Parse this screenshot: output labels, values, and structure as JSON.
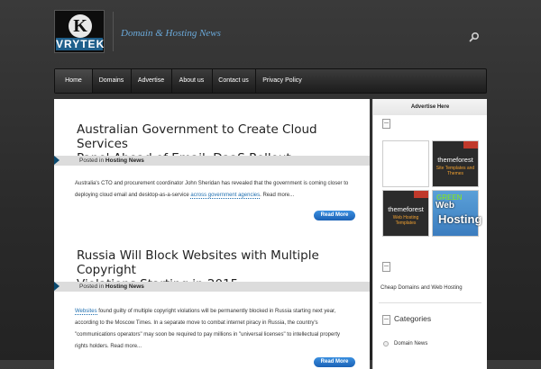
{
  "header": {
    "logo_text": "VRYTEK",
    "tagline": "Domain & Hosting News"
  },
  "nav": {
    "items": [
      "Home",
      "Domains",
      "Advertise",
      "About us",
      "Contact us",
      "Privacy Policy"
    ],
    "active": "Home"
  },
  "posts": [
    {
      "title_line1": "Australian Government to Create Cloud Services",
      "title_line2": "Panel Ahead of Email, DaaS Rollout",
      "posted_label": "Posted in",
      "category": "Hosting News",
      "excerpt_line1": "Australia's CTO and procurement coordinator John Sheridan has revealed that the government is coming closer to",
      "excerpt_line2_pre": "deploying cloud email and desktop-as-a-service ",
      "excerpt_link": "across government agencies",
      "excerpt_line2_post": ". Read more...",
      "button": "Read More"
    },
    {
      "title_line1": "Russia Will Block Websites with Multiple Copyright",
      "title_line2": "Violations Starting in 2015",
      "posted_label": "Posted in",
      "category": "Hosting News",
      "excerpt_link": "Websites",
      "excerpt_line1_post": " found guilty of multiple copyright violations will be permanently blocked in Russia starting next year,",
      "excerpt_line2": "according to the Moscow Times. In a separate move to combat internet piracy in Russia, the country's",
      "excerpt_line3": "\"communications operators\" may soon be required to pay millions in \"universal licenses\" to intellectual property",
      "excerpt_line4": "rights holders. Read more...",
      "button": "Read More"
    }
  ],
  "sidebar": {
    "advertise_heading": "Advertise Here",
    "ads": [
      {
        "brand": "themeforest",
        "sub": "Site Templates and Themes"
      },
      {
        "brand": "themeforest",
        "sub": "Web Hosting Templates"
      },
      {
        "line1": "GREEN",
        "line2": "Web",
        "line3": "Hosting"
      }
    ],
    "link_text": "Cheap Domains and Web Hosting",
    "categories_heading": "Categories",
    "categories": [
      "Domain News"
    ]
  },
  "colors": {
    "accent": "#1b62b5",
    "link": "#1f6fb0",
    "tagline": "#6aa8d8"
  },
  "icons": [
    "search-icon",
    "page-icon",
    "bullet-icon"
  ]
}
